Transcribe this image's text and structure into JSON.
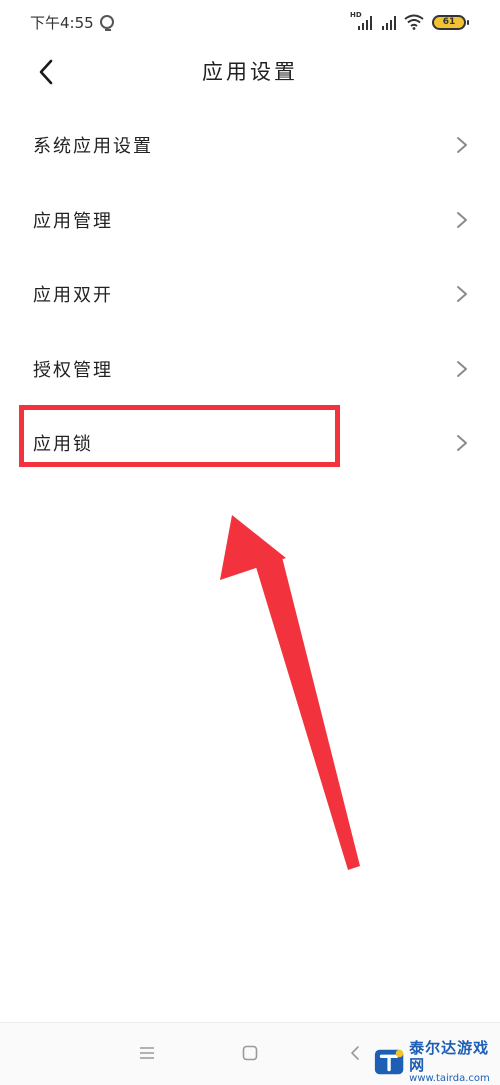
{
  "status_bar": {
    "time": "下午4:55",
    "hd_label": "HD",
    "battery_level": "61",
    "icons": [
      "alarm-icon",
      "hd-signal-icon",
      "signal-icon",
      "wifi-icon",
      "battery-icon"
    ]
  },
  "header": {
    "title": "应用设置",
    "back_icon": "chevron-left-icon"
  },
  "list": {
    "items": [
      {
        "label": "系统应用设置"
      },
      {
        "label": "应用管理"
      },
      {
        "label": "应用双开"
      },
      {
        "label": "授权管理"
      },
      {
        "label": "应用锁"
      }
    ],
    "chevron_icon": "chevron-right-icon"
  },
  "annotation": {
    "color": "#f2333d",
    "highlighted_item": "应用锁"
  },
  "nav_bar": {
    "icons": [
      "menu-icon",
      "home-icon",
      "back-icon"
    ]
  },
  "watermark": {
    "title": "泰尔达游戏网",
    "url": "www.tairda.com"
  }
}
